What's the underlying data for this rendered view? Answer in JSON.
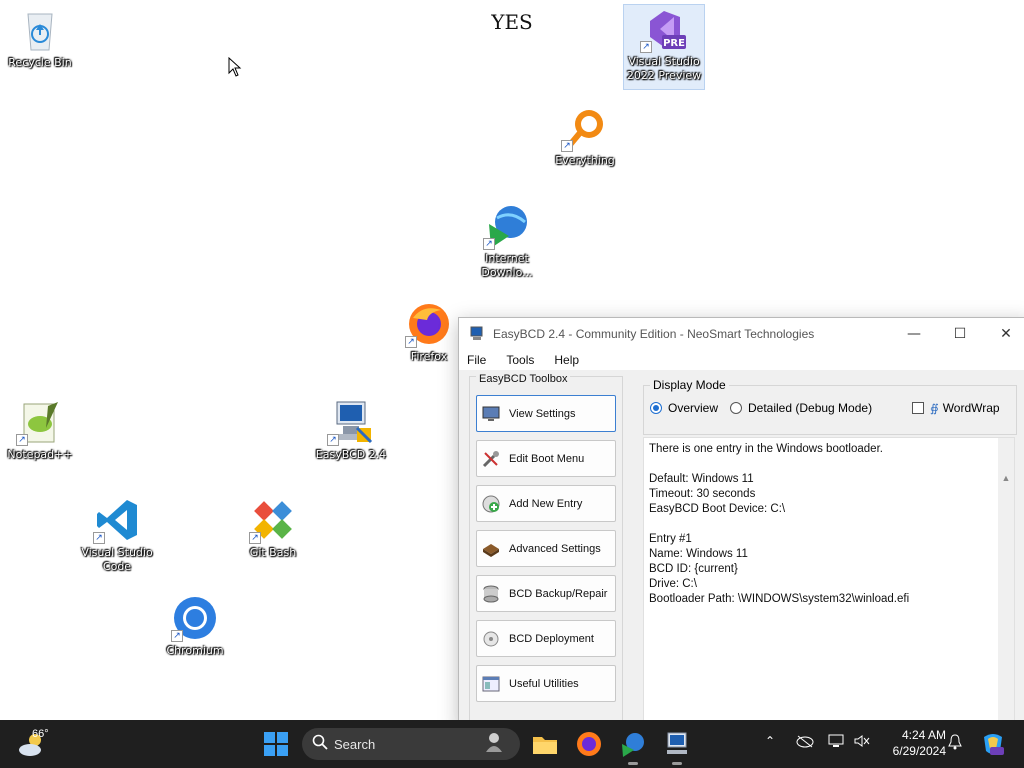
{
  "desktop": {
    "label_text": "YES",
    "icons": {
      "recycle_bin": "Recycle Bin",
      "vs_preview": "Visual Studio 2022 Preview",
      "everything": "Everything",
      "idm": "Internet Downlo...",
      "firefox": "Firefox",
      "notepadpp": "Notepad++",
      "easybcd": "EasyBCD 2.4",
      "vscode": "Visual Studio Code",
      "gitbash": "Git Bash",
      "chromium": "Chromium"
    },
    "vs_badge": "PRE"
  },
  "window": {
    "title": "EasyBCD 2.4 - Community Edition - NeoSmart Technologies",
    "menu": [
      "File",
      "Tools",
      "Help"
    ],
    "toolbox_caption": "EasyBCD Toolbox",
    "toolbox_buttons": [
      "View Settings",
      "Edit Boot Menu",
      "Add New Entry",
      "Advanced Settings",
      "BCD Backup/Repair",
      "BCD Deployment",
      "Useful Utilities"
    ],
    "display_mode": {
      "caption": "Display Mode",
      "overview": "Overview",
      "detailed": "Detailed (Debug Mode)",
      "wordwrap": "WordWrap",
      "selected": "Overview"
    },
    "output_lines": [
      "There is one entry in the Windows bootloader.",
      "",
      "Default: Windows 11",
      "Timeout: 30 seconds",
      "EasyBCD Boot Device: C:\\",
      "",
      "Entry #1",
      "Name: Windows 11",
      "BCD ID: {current}",
      "Drive: C:\\",
      "Bootloader Path: \\WINDOWS\\system32\\winload.efi"
    ]
  },
  "taskbar": {
    "weather_temp": "66°",
    "search_label": "Search",
    "time": "4:24 AM",
    "date": "6/29/2024"
  },
  "colors": {
    "taskbar_bg": "#1f1f1f",
    "accent": "#1e6fd1",
    "window_bg": "#f0f0f0"
  }
}
